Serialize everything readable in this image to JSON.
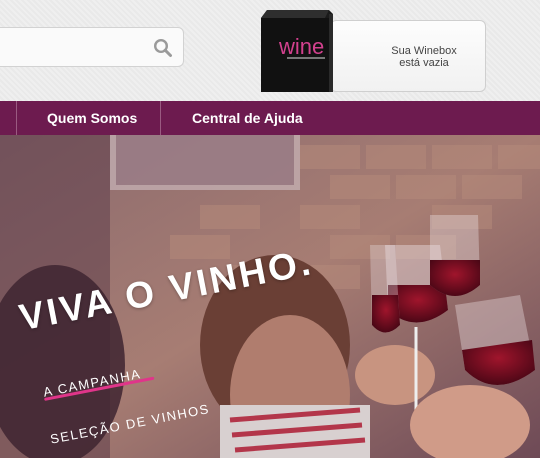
{
  "search": {
    "placeholder": "",
    "value": ""
  },
  "winebox": {
    "line1": "Sua Winebox",
    "line2": "está vazia",
    "brand": "wine"
  },
  "nav": {
    "items": [
      {
        "label": "Quem Somos"
      },
      {
        "label": "Central de Ajuda"
      }
    ]
  },
  "hero": {
    "title": "VIVA O VINHO.",
    "links": [
      {
        "label": "A CAMPANHA"
      },
      {
        "label": "SELEÇÃO DE VINHOS"
      }
    ]
  },
  "colors": {
    "nav_bg": "#6d1b4f",
    "accent": "#e0358a",
    "brand_pink": "#d2418e"
  }
}
